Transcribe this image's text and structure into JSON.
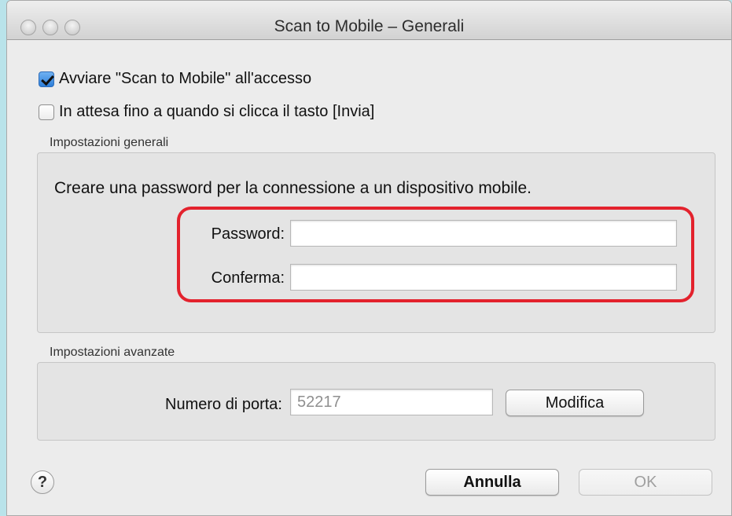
{
  "window": {
    "title": "Scan to Mobile – Generali"
  },
  "options": {
    "autostart_label": "Avviare \"Scan to Mobile\" all'accesso",
    "autostart_checked": true,
    "wait_label": "In attesa fino a quando si clicca il tasto [Invia]",
    "wait_checked": false
  },
  "general": {
    "group_label": "Impostazioni generali",
    "description": "Creare una password per la connessione a un dispositivo mobile.",
    "password_label": "Password:",
    "password_value": "",
    "confirm_label": "Conferma:",
    "confirm_value": ""
  },
  "advanced": {
    "group_label": "Impostazioni avanzate",
    "port_label": "Numero di porta:",
    "port_value": "52217",
    "modify_label": "Modifica"
  },
  "footer": {
    "help_label": "?",
    "cancel_label": "Annulla",
    "ok_label": "OK"
  },
  "colors": {
    "highlight": "#e3222d",
    "accent": "#2d7ed9"
  }
}
